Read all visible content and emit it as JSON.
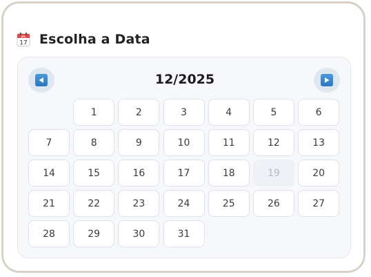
{
  "header": {
    "icon": "calendar-icon",
    "icon_month": "JUL",
    "icon_day": "17",
    "title": "Escolha a Data"
  },
  "calendar": {
    "month_label": "12/2025",
    "prev_icon": "prev-arrow-icon",
    "next_icon": "next-arrow-icon",
    "leading_empty": 1,
    "days": [
      {
        "label": "1",
        "disabled": false
      },
      {
        "label": "2",
        "disabled": false
      },
      {
        "label": "3",
        "disabled": false
      },
      {
        "label": "4",
        "disabled": false
      },
      {
        "label": "5",
        "disabled": false
      },
      {
        "label": "6",
        "disabled": false
      },
      {
        "label": "7",
        "disabled": false
      },
      {
        "label": "8",
        "disabled": false
      },
      {
        "label": "9",
        "disabled": false
      },
      {
        "label": "10",
        "disabled": false
      },
      {
        "label": "11",
        "disabled": false
      },
      {
        "label": "12",
        "disabled": false
      },
      {
        "label": "13",
        "disabled": false
      },
      {
        "label": "14",
        "disabled": false
      },
      {
        "label": "15",
        "disabled": false
      },
      {
        "label": "16",
        "disabled": false
      },
      {
        "label": "17",
        "disabled": false
      },
      {
        "label": "18",
        "disabled": false
      },
      {
        "label": "19",
        "disabled": true
      },
      {
        "label": "20",
        "disabled": false
      },
      {
        "label": "21",
        "disabled": false
      },
      {
        "label": "22",
        "disabled": false
      },
      {
        "label": "23",
        "disabled": false
      },
      {
        "label": "24",
        "disabled": false
      },
      {
        "label": "25",
        "disabled": false
      },
      {
        "label": "26",
        "disabled": false
      },
      {
        "label": "27",
        "disabled": false
      },
      {
        "label": "28",
        "disabled": false
      },
      {
        "label": "29",
        "disabled": false
      },
      {
        "label": "30",
        "disabled": false
      },
      {
        "label": "31",
        "disabled": false
      }
    ]
  },
  "colors": {
    "accent": "#2a78c2",
    "frame_border": "#d8d1c8",
    "panel_bg": "#f6f8fb",
    "icon_red": "#e04848"
  }
}
